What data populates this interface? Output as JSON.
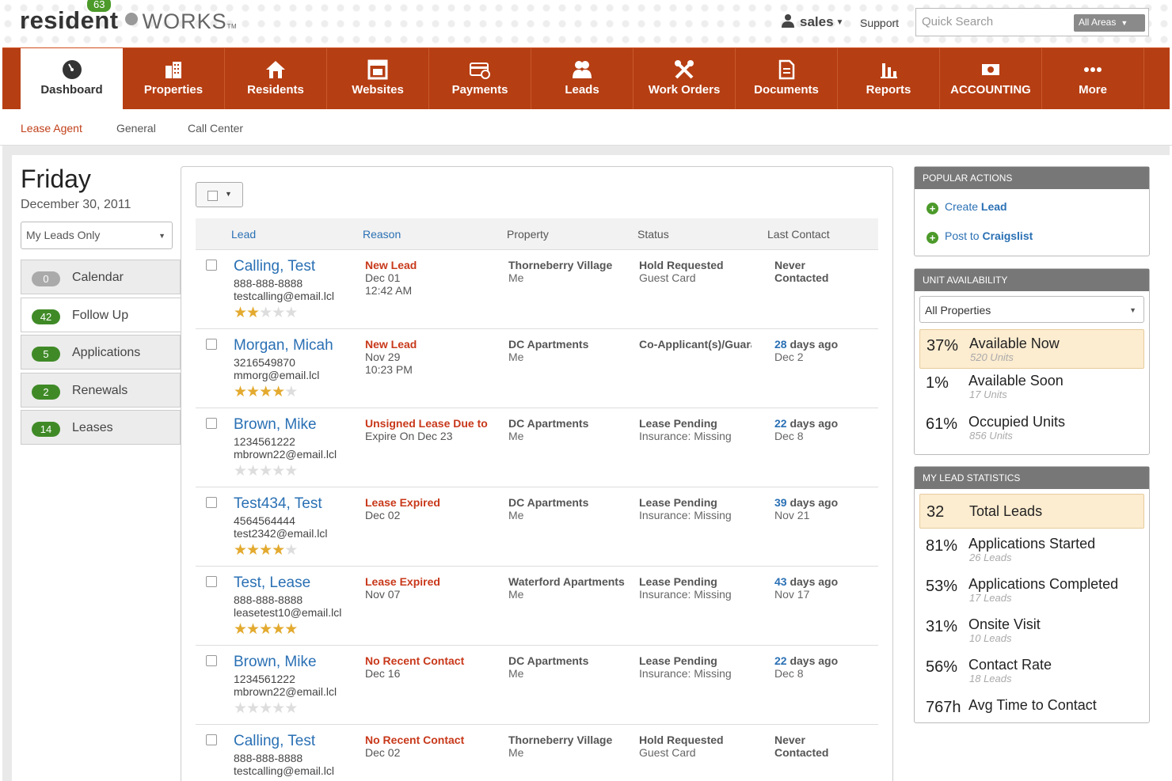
{
  "header": {
    "logo_resident": "resident",
    "logo_works": "WORKS",
    "logo_tm": "TM",
    "user": "sales",
    "support": "Support",
    "search_placeholder": "Quick Search",
    "areas": "All Areas"
  },
  "nav": {
    "badge": "63",
    "items": [
      {
        "label": "Dashboard",
        "icon": "dashboard-icon"
      },
      {
        "label": "Properties",
        "icon": "building-icon"
      },
      {
        "label": "Residents",
        "icon": "home-icon"
      },
      {
        "label": "Websites",
        "icon": "website-icon"
      },
      {
        "label": "Payments",
        "icon": "payment-icon"
      },
      {
        "label": "Leads",
        "icon": "people-icon"
      },
      {
        "label": "Work Orders",
        "icon": "tools-icon"
      },
      {
        "label": "Documents",
        "icon": "document-icon"
      },
      {
        "label": "Reports",
        "icon": "bar-chart-icon"
      },
      {
        "label": "ACCOUNTING",
        "icon": "money-icon"
      },
      {
        "label": "More",
        "icon": "more-icon"
      }
    ]
  },
  "subnav": [
    "Lease Agent",
    "General",
    "Call Center"
  ],
  "left": {
    "day": "Friday",
    "date": "December 30, 2011",
    "filter": "My Leads Only",
    "items": [
      {
        "count": "0",
        "label": "Calendar"
      },
      {
        "count": "42",
        "label": "Follow Up"
      },
      {
        "count": "5",
        "label": "Applications"
      },
      {
        "count": "2",
        "label": "Renewals"
      },
      {
        "count": "14",
        "label": "Leases"
      }
    ]
  },
  "table": {
    "headers": {
      "lead": "Lead",
      "reason": "Reason",
      "property": "Property",
      "status": "Status",
      "last_contact": "Last Contact"
    },
    "rows": [
      {
        "name": "Calling, Test",
        "phone": "888-888-8888",
        "email": "testcalling@email.lcl",
        "stars": 2,
        "reason": "New Lead",
        "reason2": "Dec 01",
        "reason3": "12:42 AM",
        "property": "Thorneberry Village",
        "property2": "Me",
        "status": "Hold Requested",
        "status2": "Guest Card",
        "lc_num": "",
        "lc_text": "Never",
        "lc2": "Contacted"
      },
      {
        "name": "Morgan, Micah",
        "phone": "3216549870",
        "email": "mmorg@email.lcl",
        "stars": 4,
        "reason": "New Lead",
        "reason2": "Nov 29",
        "reason3": "10:23 PM",
        "property": "DC Apartments",
        "property2": "Me",
        "status": "Co-Applicant(s)/Guarantor",
        "status2": "",
        "lc_num": "28",
        "lc_text": " days ago",
        "lc2": "Dec 2"
      },
      {
        "name": "Brown, Mike",
        "phone": "1234561222",
        "email": "mbrown22@email.lcl",
        "stars": 0,
        "reason": "Unsigned Lease Due to",
        "reason2": "Expire On Dec 23",
        "reason3": "",
        "property": "DC Apartments",
        "property2": "Me",
        "status": "Lease Pending",
        "status2": "Insurance: Missing",
        "lc_num": "22",
        "lc_text": " days ago",
        "lc2": "Dec 8"
      },
      {
        "name": "Test434, Test",
        "phone": "4564564444",
        "email": "test2342@email.lcl",
        "stars": 4,
        "reason": "Lease Expired",
        "reason2": "Dec 02",
        "reason3": "",
        "property": "DC Apartments",
        "property2": "Me",
        "status": "Lease Pending",
        "status2": "Insurance: Missing",
        "lc_num": "39",
        "lc_text": " days ago",
        "lc2": "Nov 21"
      },
      {
        "name": "Test, Lease",
        "phone": "888-888-8888",
        "email": "leasetest10@email.lcl",
        "stars": 5,
        "reason": "Lease Expired",
        "reason2": "Nov 07",
        "reason3": "",
        "property": "Waterford Apartments",
        "property2": "Me",
        "status": "Lease Pending",
        "status2": "Insurance: Missing",
        "lc_num": "43",
        "lc_text": " days ago",
        "lc2": "Nov 17"
      },
      {
        "name": "Brown, Mike",
        "phone": "1234561222",
        "email": "mbrown22@email.lcl",
        "stars": 0,
        "reason": "No Recent Contact",
        "reason2": "Dec 16",
        "reason3": "",
        "property": "DC Apartments",
        "property2": "Me",
        "status": "Lease Pending",
        "status2": "Insurance: Missing",
        "lc_num": "22",
        "lc_text": " days ago",
        "lc2": "Dec 8"
      },
      {
        "name": "Calling, Test",
        "phone": "888-888-8888",
        "email": "testcalling@email.lcl",
        "stars": 0,
        "reason": "No Recent Contact",
        "reason2": "Dec 02",
        "reason3": "",
        "property": "Thorneberry Village",
        "property2": "Me",
        "status": "Hold Requested",
        "status2": "Guest Card",
        "lc_num": "",
        "lc_text": "Never",
        "lc2": "Contacted"
      }
    ]
  },
  "popular_actions": {
    "title": "Popular Actions",
    "items": [
      {
        "pre": "Create ",
        "bold": "Lead"
      },
      {
        "pre": "Post to ",
        "bold": "Craigslist"
      }
    ]
  },
  "unit_availability": {
    "title": "Unit Availability",
    "select": "All Properties",
    "stats": [
      {
        "pct": "37%",
        "label": "Available Now",
        "sub": "520 Units"
      },
      {
        "pct": "1%",
        "label": "Available Soon",
        "sub": "17 Units"
      },
      {
        "pct": "61%",
        "label": "Occupied Units",
        "sub": "856 Units"
      }
    ]
  },
  "lead_stats": {
    "title": "My Lead Statistics",
    "stats": [
      {
        "pct": "32",
        "label": "Total Leads",
        "sub": ""
      },
      {
        "pct": "81%",
        "label": "Applications Started",
        "sub": "26 Leads"
      },
      {
        "pct": "53%",
        "label": "Applications Completed",
        "sub": "17 Leads"
      },
      {
        "pct": "31%",
        "label": "Onsite Visit",
        "sub": "10 Leads"
      },
      {
        "pct": "56%",
        "label": "Contact Rate",
        "sub": "18 Leads"
      },
      {
        "pct": "767h",
        "label": "Avg Time to Contact",
        "sub": ""
      }
    ]
  },
  "colors": {
    "brand": "#b63e13",
    "accent_green": "#3f8a27",
    "link": "#2a70b4",
    "alert": "#c8381a"
  }
}
